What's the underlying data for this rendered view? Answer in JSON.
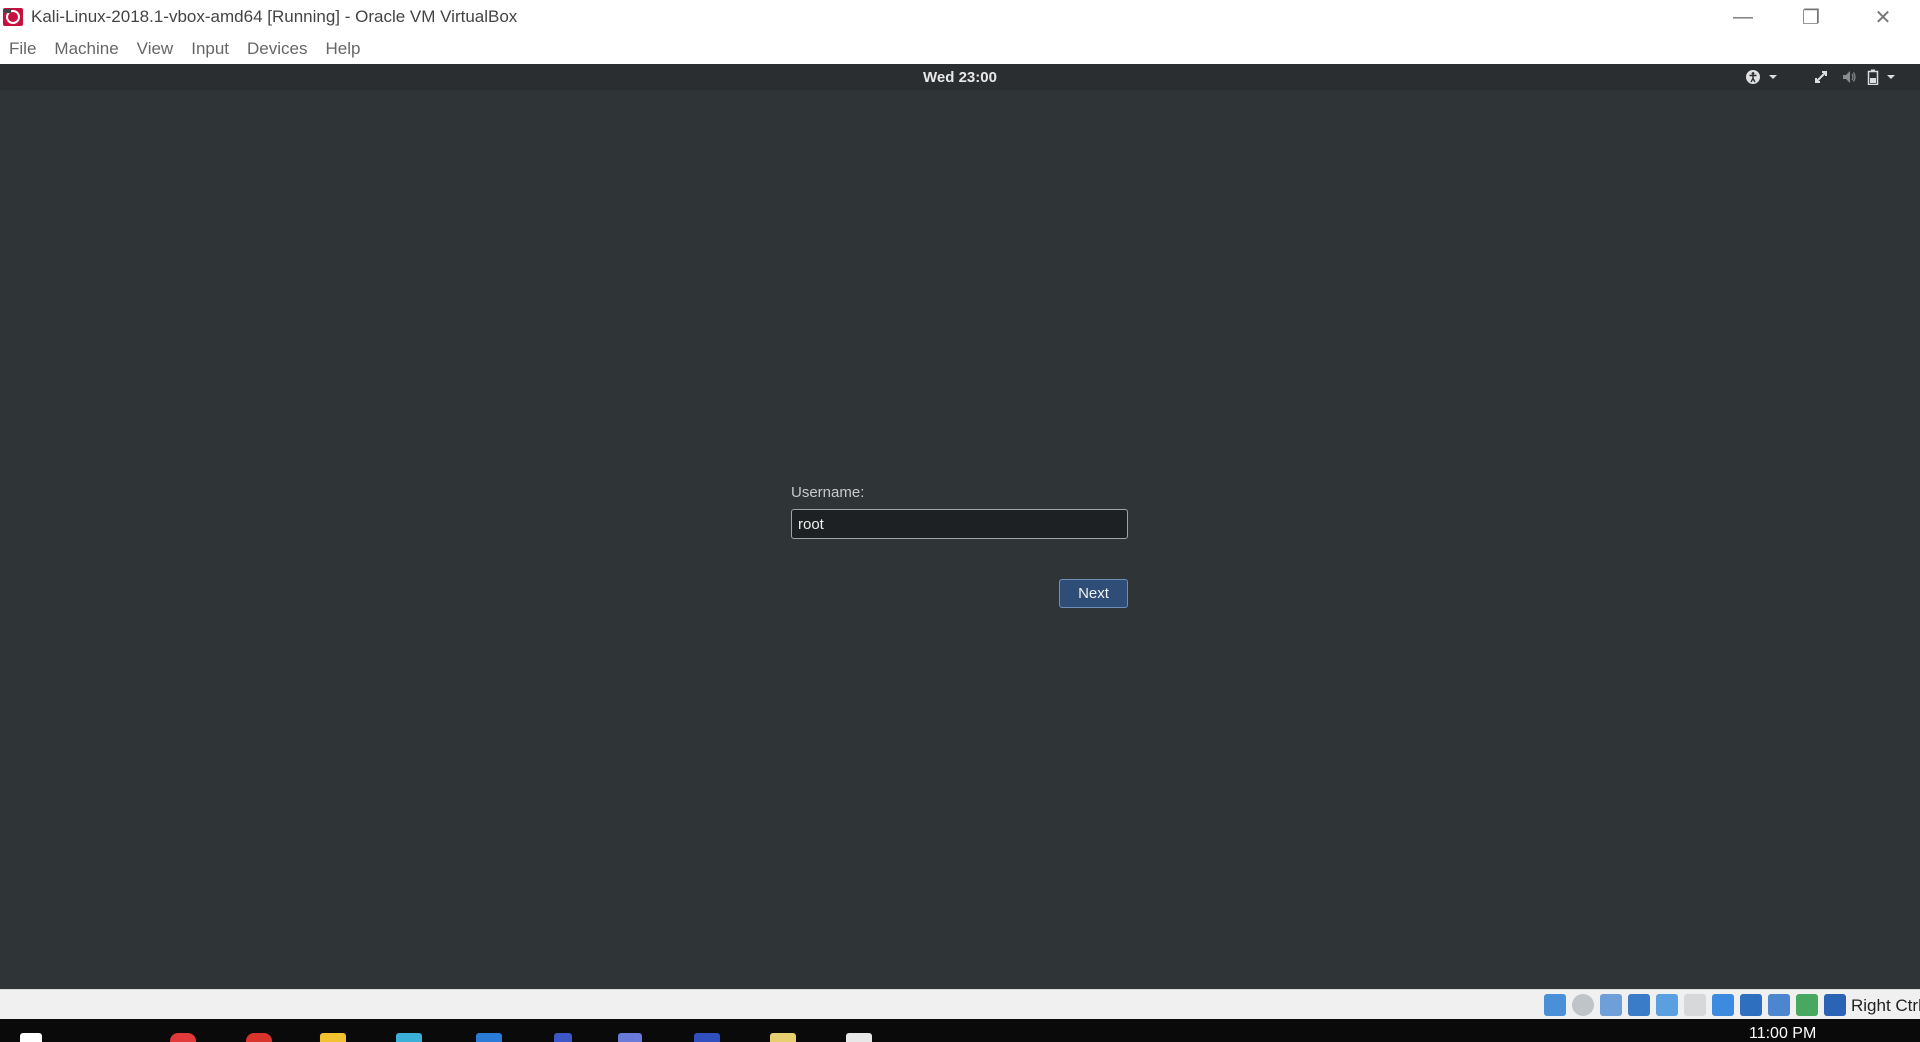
{
  "window": {
    "title": "Kali-Linux-2018.1-vbox-amd64 [Running] - Oracle VM VirtualBox",
    "app_icon": "virtualbox-icon",
    "controls": {
      "minimize": "—",
      "maximize": "❐",
      "close": "✕"
    }
  },
  "menubar": {
    "items": [
      "File",
      "Machine",
      "View",
      "Input",
      "Devices",
      "Help"
    ]
  },
  "guest": {
    "clock": "Wed 23:00",
    "tray_icons": [
      "accessibility-icon",
      "chevron-down-icon",
      "network-icon",
      "volume-icon",
      "battery-icon",
      "chevron-down-icon"
    ],
    "login": {
      "label": "Username:",
      "value": "root",
      "next_label": "Next"
    }
  },
  "statusbar": {
    "icons": [
      "hard-disk-icon",
      "optical-drive-icon",
      "audio-icon",
      "network-adapter-icon",
      "usb-icon",
      "shared-folders-icon",
      "display-icon",
      "video-capture-icon",
      "cpu-icon",
      "mouse-integration-icon",
      "keyboard-capture-icon"
    ],
    "host_key": "Right Ctrl"
  },
  "taskbar": {
    "time": "11:00 PM"
  },
  "colors": {
    "guest_bg": "#2f3437",
    "accent_button": "#2e4e78"
  }
}
